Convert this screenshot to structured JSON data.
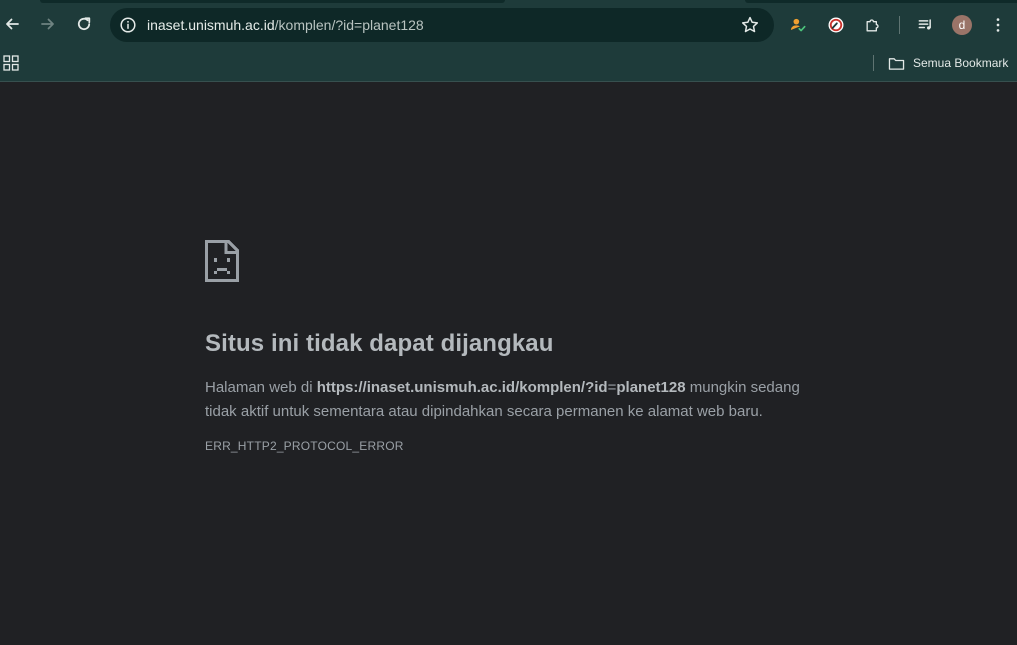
{
  "browser": {
    "url_host": "inaset.unismuh.ac.id",
    "url_path": "/komplen/?id=planet128",
    "profile_initial": "d",
    "bookmarks_bar": {
      "all_bookmarks_label": "Semua Bookmark"
    }
  },
  "error_page": {
    "title": "Situs ini tidak dapat dijangkau",
    "desc_prefix": "Halaman web di ",
    "desc_url": "https://inaset.unismuh.ac.id/komplen/?id",
    "desc_eq": "=",
    "desc_url_tail": "planet128",
    "desc_suffix": " mungkin sedang tidak aktif untuk sementara atau dipindahkan secara permanen ke alamat web baru.",
    "error_code": "ERR_HTTP2_PROTOCOL_ERROR"
  },
  "colors": {
    "toolbar_bg": "#1e3b3a",
    "omnibox_bg": "#0e2827",
    "page_bg": "#202124"
  }
}
